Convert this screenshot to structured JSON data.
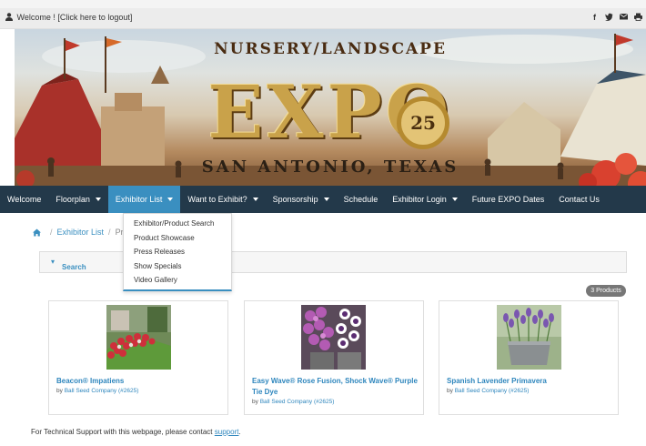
{
  "topbar": {
    "welcome": "Welcome !",
    "logout": "[Click here to logout]",
    "social": [
      "f",
      "t",
      "mail",
      "print"
    ]
  },
  "banner": {
    "top_text": "NURSERY/LANDSCAPE",
    "expo_text": "EXPO",
    "year_badge": "25",
    "city_text": "SAN ANTONIO, TEXAS"
  },
  "nav": {
    "items": [
      {
        "label": "Welcome",
        "caret": false
      },
      {
        "label": "Floorplan",
        "caret": true
      },
      {
        "label": "Exhibitor List",
        "caret": true,
        "active": true
      },
      {
        "label": "Want to Exhibit?",
        "caret": true
      },
      {
        "label": "Sponsorship",
        "caret": true
      },
      {
        "label": "Schedule",
        "caret": false
      },
      {
        "label": "Exhibitor Login",
        "caret": true
      },
      {
        "label": "Future EXPO Dates",
        "caret": false
      },
      {
        "label": "Contact Us",
        "caret": false
      }
    ],
    "accent_color": "#3a8fc0",
    "bar_color": "#23394a"
  },
  "dropdown": {
    "items": [
      "Exhibitor/Product Search",
      "Product Showcase",
      "Press Releases",
      "Show Specials",
      "Video Gallery"
    ]
  },
  "breadcrumb": {
    "home_icon": "home-icon",
    "link": "Exhibitor List",
    "current": "Pro"
  },
  "search": {
    "label": "Search"
  },
  "results": {
    "count": "3 Products",
    "products": [
      {
        "title": "Beacon® Impatiens",
        "by": "by",
        "company": "Ball Seed Company",
        "booth": "(#2625)"
      },
      {
        "title": "Easy Wave® Rose Fusion, Shock Wave® Purple Tie Dye",
        "by": "by",
        "company": "Ball Seed Company",
        "booth": "(#2625)"
      },
      {
        "title": "Spanish Lavender Primavera",
        "by": "by",
        "company": "Ball Seed Company",
        "booth": "(#2625)"
      }
    ]
  },
  "footer": {
    "text": "For Technical Support with this webpage, please contact",
    "link": "support",
    "end": "."
  }
}
